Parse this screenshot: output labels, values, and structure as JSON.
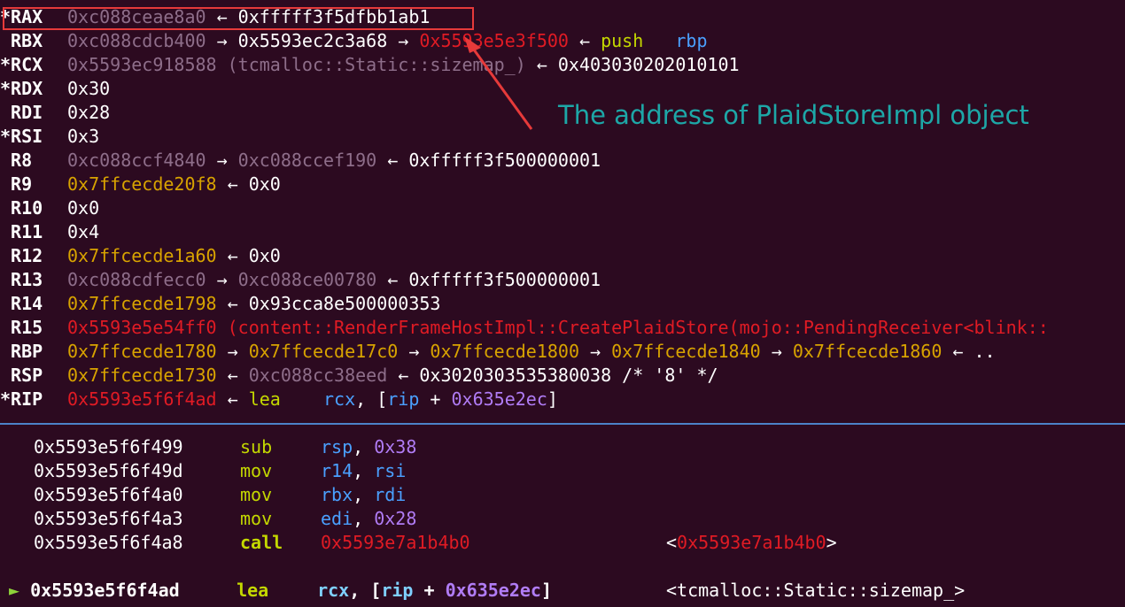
{
  "registers": [
    {
      "star": "*",
      "name": "RAX",
      "parts": [
        {
          "t": "0xc088ceae8a0",
          "c": "gray"
        },
        {
          "t": " ← ",
          "c": "white"
        },
        {
          "t": "0xfffff3f5dfbb1ab1",
          "c": "white"
        }
      ]
    },
    {
      "star": " ",
      "name": "RBX",
      "parts": [
        {
          "t": "0xc088cdcb400",
          "c": "gray"
        },
        {
          "t": " → ",
          "c": "white"
        },
        {
          "t": "0x5593ec2c3a68",
          "c": "white"
        },
        {
          "t": " → ",
          "c": "white"
        },
        {
          "t": "0x5593e5e3f500",
          "c": "red"
        },
        {
          "t": " ← ",
          "c": "white"
        },
        {
          "t": "push",
          "c": "green"
        },
        {
          "t": "   ",
          "c": "white"
        },
        {
          "t": "rbp",
          "c": "blue"
        }
      ]
    },
    {
      "star": "*",
      "name": "RCX",
      "parts": [
        {
          "t": "0x5593ec918588 (tcmalloc::Static::sizemap_)",
          "c": "gray"
        },
        {
          "t": " ← ",
          "c": "white"
        },
        {
          "t": "0x403030202010101",
          "c": "white"
        }
      ]
    },
    {
      "star": "*",
      "name": "RDX",
      "parts": [
        {
          "t": "0x30",
          "c": "white"
        }
      ]
    },
    {
      "star": " ",
      "name": "RDI",
      "parts": [
        {
          "t": "0x28",
          "c": "white"
        }
      ]
    },
    {
      "star": "*",
      "name": "RSI",
      "parts": [
        {
          "t": "0x3",
          "c": "white"
        }
      ]
    },
    {
      "star": " ",
      "name": "R8",
      "parts": [
        {
          "t": "0xc088ccf4840",
          "c": "gray"
        },
        {
          "t": " → ",
          "c": "white"
        },
        {
          "t": "0xc088ccef190",
          "c": "gray"
        },
        {
          "t": " ← ",
          "c": "white"
        },
        {
          "t": "0xfffff3f500000001",
          "c": "white"
        }
      ]
    },
    {
      "star": " ",
      "name": "R9",
      "parts": [
        {
          "t": "0x7ffcecde20f8",
          "c": "yellow"
        },
        {
          "t": " ← ",
          "c": "white"
        },
        {
          "t": "0x0",
          "c": "white"
        }
      ]
    },
    {
      "star": " ",
      "name": "R10",
      "parts": [
        {
          "t": "0x0",
          "c": "white"
        }
      ]
    },
    {
      "star": " ",
      "name": "R11",
      "parts": [
        {
          "t": "0x4",
          "c": "white"
        }
      ]
    },
    {
      "star": " ",
      "name": "R12",
      "parts": [
        {
          "t": "0x7ffcecde1a60",
          "c": "yellow"
        },
        {
          "t": " ← ",
          "c": "white"
        },
        {
          "t": "0x0",
          "c": "white"
        }
      ]
    },
    {
      "star": " ",
      "name": "R13",
      "parts": [
        {
          "t": "0xc088cdfecc0",
          "c": "gray"
        },
        {
          "t": " → ",
          "c": "white"
        },
        {
          "t": "0xc088ce00780",
          "c": "gray"
        },
        {
          "t": " ← ",
          "c": "white"
        },
        {
          "t": "0xfffff3f500000001",
          "c": "white"
        }
      ]
    },
    {
      "star": " ",
      "name": "R14",
      "parts": [
        {
          "t": "0x7ffcecde1798",
          "c": "yellow"
        },
        {
          "t": " ← ",
          "c": "white"
        },
        {
          "t": "0x93cca8e500000353",
          "c": "white"
        }
      ]
    },
    {
      "star": " ",
      "name": "R15",
      "parts": [
        {
          "t": "0x5593e5e54ff0 (content::RenderFrameHostImpl::CreatePlaidStore(mojo::PendingReceiver<blink::",
          "c": "red"
        }
      ]
    },
    {
      "star": " ",
      "name": "RBP",
      "parts": [
        {
          "t": "0x7ffcecde1780",
          "c": "yellow"
        },
        {
          "t": " → ",
          "c": "white"
        },
        {
          "t": "0x7ffcecde17c0",
          "c": "yellow"
        },
        {
          "t": " → ",
          "c": "white"
        },
        {
          "t": "0x7ffcecde1800",
          "c": "yellow"
        },
        {
          "t": " → ",
          "c": "white"
        },
        {
          "t": "0x7ffcecde1840",
          "c": "yellow"
        },
        {
          "t": " → ",
          "c": "white"
        },
        {
          "t": "0x7ffcecde1860",
          "c": "yellow"
        },
        {
          "t": " ← ..",
          "c": "white"
        }
      ]
    },
    {
      "star": " ",
      "name": "RSP",
      "parts": [
        {
          "t": "0x7ffcecde1730",
          "c": "yellow"
        },
        {
          "t": " ← ",
          "c": "white"
        },
        {
          "t": "0xc088cc38eed",
          "c": "gray"
        },
        {
          "t": " ← ",
          "c": "white"
        },
        {
          "t": "0x3020303535380038 /* '8' */",
          "c": "white"
        }
      ]
    },
    {
      "star": "*",
      "name": "RIP",
      "parts": [
        {
          "t": "0x5593e5f6f4ad",
          "c": "red"
        },
        {
          "t": " ← ",
          "c": "white"
        },
        {
          "t": "lea",
          "c": "green"
        },
        {
          "t": "    ",
          "c": "white"
        },
        {
          "t": "rcx",
          "c": "blue"
        },
        {
          "t": ", [",
          "c": "white"
        },
        {
          "t": "rip",
          "c": "blue"
        },
        {
          "t": " + ",
          "c": "white"
        },
        {
          "t": "0x635e2ec",
          "c": "purple"
        },
        {
          "t": "]",
          "c": "white"
        }
      ]
    }
  ],
  "annotation": "The address of PlaidStoreImpl object",
  "disasm": [
    {
      "marker": "",
      "addr": "0x5593e5f6f499",
      "mnemonic": "sub",
      "ops": [
        {
          "t": "rsp",
          "c": "blue"
        },
        {
          "t": ", ",
          "c": "white"
        },
        {
          "t": "0x38",
          "c": "purple"
        }
      ],
      "comment": [],
      "current": false
    },
    {
      "marker": "",
      "addr": "0x5593e5f6f49d",
      "mnemonic": "mov",
      "ops": [
        {
          "t": "r14",
          "c": "blue"
        },
        {
          "t": ", ",
          "c": "white"
        },
        {
          "t": "rsi",
          "c": "blue"
        }
      ],
      "comment": [],
      "current": false
    },
    {
      "marker": "",
      "addr": "0x5593e5f6f4a0",
      "mnemonic": "mov",
      "ops": [
        {
          "t": "rbx",
          "c": "blue"
        },
        {
          "t": ", ",
          "c": "white"
        },
        {
          "t": "rdi",
          "c": "blue"
        }
      ],
      "comment": [],
      "current": false
    },
    {
      "marker": "",
      "addr": "0x5593e5f6f4a3",
      "mnemonic": "mov",
      "ops": [
        {
          "t": "edi",
          "c": "blue"
        },
        {
          "t": ", ",
          "c": "white"
        },
        {
          "t": "0x28",
          "c": "purple"
        }
      ],
      "comment": [],
      "current": false
    },
    {
      "marker": "",
      "addr": "0x5593e5f6f4a8",
      "mnemonic": "call",
      "ops": [
        {
          "t": "0x5593e7a1b4b0",
          "c": "red"
        }
      ],
      "comment": [
        {
          "t": "<",
          "c": "white"
        },
        {
          "t": "0x5593e7a1b4b0",
          "c": "red"
        },
        {
          "t": ">",
          "c": "white"
        }
      ],
      "current": false,
      "boldmn": true
    },
    {
      "marker": "►",
      "addr": "0x5593e5f6f4ad",
      "mnemonic": "lea",
      "ops": [
        {
          "t": "rcx",
          "c": "cyan"
        },
        {
          "t": ", [",
          "c": "white"
        },
        {
          "t": "rip",
          "c": "cyan"
        },
        {
          "t": " + ",
          "c": "white"
        },
        {
          "t": "0x635e2ec",
          "c": "purple"
        },
        {
          "t": "]",
          "c": "white"
        }
      ],
      "comment": [
        {
          "t": "<tcmalloc::Static::sizemap_>",
          "c": "white"
        }
      ],
      "current": true,
      "boldmn": true
    }
  ],
  "colors": {
    "background": "#2c0a20",
    "highlight_box": "#e63a3a",
    "annotation": "#1da7a7",
    "separator": "#4c82c8"
  }
}
